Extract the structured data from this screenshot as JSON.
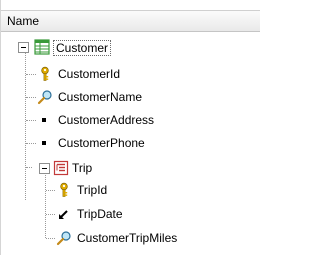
{
  "header": {
    "column_label": "Name"
  },
  "tree": {
    "root": {
      "label": "Customer",
      "icon": "level-table-icon",
      "children": [
        {
          "label": "CustomerId",
          "icon": "key-icon"
        },
        {
          "label": "CustomerName",
          "icon": "description-attribute-icon"
        },
        {
          "label": "CustomerAddress",
          "icon": "attribute-bullet-icon"
        },
        {
          "label": "CustomerPhone",
          "icon": "attribute-bullet-icon"
        },
        {
          "label": "Trip",
          "icon": "sublevel-icon",
          "children": [
            {
              "label": "TripId",
              "icon": "key-icon"
            },
            {
              "label": "TripDate",
              "icon": "foreign-attribute-icon"
            },
            {
              "label": "CustomerTripMiles",
              "icon": "description-attribute-icon"
            }
          ]
        }
      ]
    }
  },
  "colors": {
    "level_icon": "#3a9a3a",
    "sublevel_icon": "#c23a3a",
    "key_icon": "#d9a300",
    "connector": "#9a9a9a"
  }
}
